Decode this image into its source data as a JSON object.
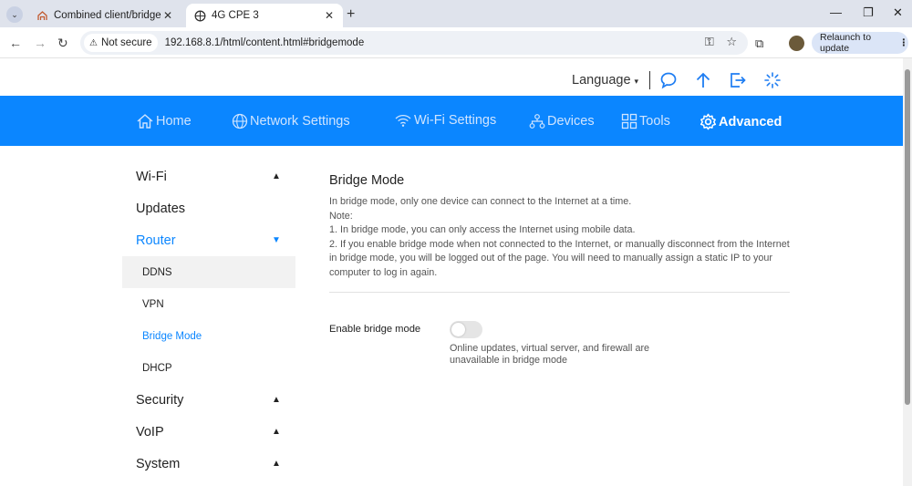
{
  "browser": {
    "tabs": [
      {
        "title": "Combined client/bridge or brid",
        "active": false
      },
      {
        "title": "4G CPE 3",
        "active": true
      }
    ],
    "security_label": "Not secure",
    "url": "192.168.8.1/html/content.html#bridgemode",
    "relaunch_label": "Relaunch to update"
  },
  "topbar": {
    "language_label": "Language"
  },
  "nav": {
    "items": [
      {
        "label": "Home",
        "icon": "home-icon"
      },
      {
        "label": "Network Settings",
        "icon": "globe-icon"
      },
      {
        "label": "Wi-Fi Settings",
        "icon": "wifi-icon"
      },
      {
        "label": "Devices",
        "icon": "devices-icon"
      },
      {
        "label": "Tools",
        "icon": "tools-icon"
      },
      {
        "label": "Advanced",
        "icon": "gear-icon",
        "active": true
      }
    ]
  },
  "sidebar": {
    "items": [
      {
        "label": "Wi-Fi"
      },
      {
        "label": "Updates"
      },
      {
        "label": "Router",
        "expanded": true
      },
      {
        "label": "DDNS"
      },
      {
        "label": "VPN"
      },
      {
        "label": "Bridge Mode",
        "current": true
      },
      {
        "label": "DHCP"
      },
      {
        "label": "Security"
      },
      {
        "label": "VoIP"
      },
      {
        "label": "System"
      }
    ]
  },
  "content": {
    "title": "Bridge Mode",
    "lines": [
      "In bridge mode, only one device can connect to the Internet at a time.",
      "Note:",
      "1. In bridge mode, you can only access the Internet using mobile data.",
      "2. If you enable bridge mode when not connected to the Internet, or manually disconnect from the Internet in bridge mode, you will be logged out of the page. You will need to manually assign a static IP to your computer to log in again."
    ],
    "field_label": "Enable bridge mode",
    "field_value": "off",
    "field_hint": "Online updates, virtual server, and firewall are unavailable in bridge mode"
  },
  "colors": {
    "accent": "#0b86ff",
    "nav_bg": "#0b86ff"
  }
}
